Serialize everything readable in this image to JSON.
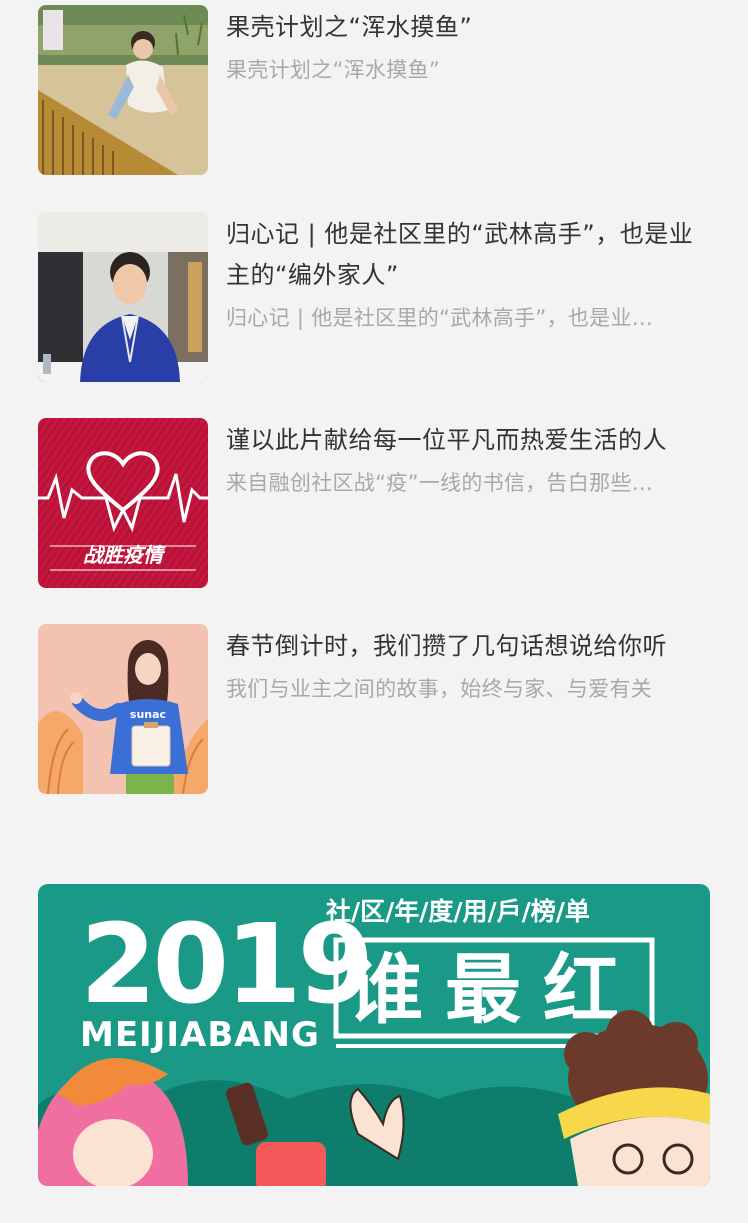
{
  "articles": [
    {
      "title": "果壳计划之“浑水摸鱼”",
      "summary": "果壳计划之“浑水摸鱼”",
      "image": "children-in-rice-field-photo"
    },
    {
      "title": "归心记 | 他是社区里的“武林高手”，也是业主的“编外家人”",
      "summary": "归心记 | 他是社区里的“武林高手”，也是业…",
      "image": "staff-in-lobby-photo"
    },
    {
      "title": "谨以此片献给每一位平凡而热爱生活的人",
      "summary": "来自融创社区战“疫”一线的书信，告白那些…",
      "image": "heartbeat-heart-illustration",
      "image_caption": "战胜疫情"
    },
    {
      "title": "春节倒计时，我们攒了几句话想说给你听",
      "summary": "我们与业主之间的故事，始终与家、与爱有关",
      "image": "woman-with-clipboard-illustration",
      "image_caption": "sunac"
    }
  ],
  "banner": {
    "year": "2019",
    "subtitle": "社/区/年/度/用/戶/榜/单",
    "brand": "MEIJIABANG",
    "headline": "谁最红",
    "colors": {
      "teal": "#1a9a86",
      "white": "#ffffff",
      "pink": "#f06fa0",
      "orange": "#f28a3c",
      "yellow": "#f7d84a",
      "brown": "#6b3a2a"
    }
  }
}
